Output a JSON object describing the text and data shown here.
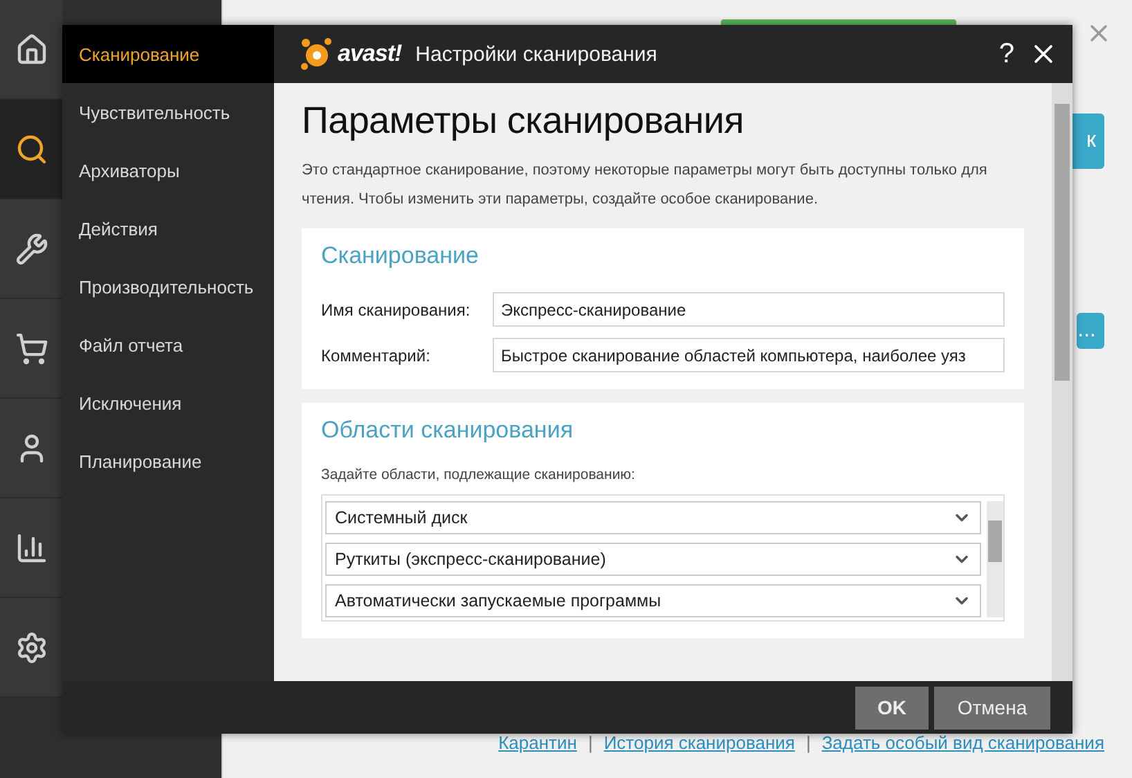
{
  "app": {
    "nav": [
      {
        "kind": "home",
        "selected": false
      },
      {
        "kind": "search",
        "selected": true
      },
      {
        "kind": "tools",
        "selected": false
      },
      {
        "kind": "cart",
        "selected": false
      },
      {
        "kind": "user",
        "selected": false
      },
      {
        "kind": "stats",
        "selected": false
      },
      {
        "kind": "settings",
        "selected": false
      }
    ],
    "partial_buttons": [
      "к",
      "..."
    ],
    "link_separator": "|",
    "links": [
      "Карантин",
      "История сканирования",
      "Задать особый вид сканирования"
    ]
  },
  "dialog": {
    "logo": "avast!",
    "title": "Настройки сканирования",
    "help": "?",
    "menu": [
      {
        "label": "Сканирование",
        "selected": true
      },
      {
        "label": "Чувствительность",
        "selected": false
      },
      {
        "label": "Архиваторы",
        "selected": false
      },
      {
        "label": "Действия",
        "selected": false
      },
      {
        "label": "Производительность",
        "selected": false
      },
      {
        "label": "Файл отчета",
        "selected": false
      },
      {
        "label": "Исключения",
        "selected": false
      },
      {
        "label": "Планирование",
        "selected": false
      }
    ],
    "heading": "Параметры сканирования",
    "intro": "Это стандартное сканирование, поэтому некоторые параметры могут быть доступны только для чтения. Чтобы изменить эти параметры, создайте особое сканирование.",
    "scan_section": {
      "title": "Сканирование",
      "fields": [
        {
          "label": "Имя сканирования:",
          "value": "Экспресс-сканирование"
        },
        {
          "label": "Комментарий:",
          "value": "Быстрое сканирование областей компьютера, наиболее уяз"
        }
      ]
    },
    "areas_section": {
      "title": "Области сканирования",
      "hint": "Задайте области, подлежащие сканированию:",
      "areas": [
        "Системный диск",
        "Руткиты (экспресс-сканирование)",
        "Автоматически запускаемые программы"
      ]
    },
    "buttons": [
      {
        "label": "OK",
        "kind": "primary"
      },
      {
        "label": "Отмена",
        "kind": "secondary"
      }
    ]
  }
}
